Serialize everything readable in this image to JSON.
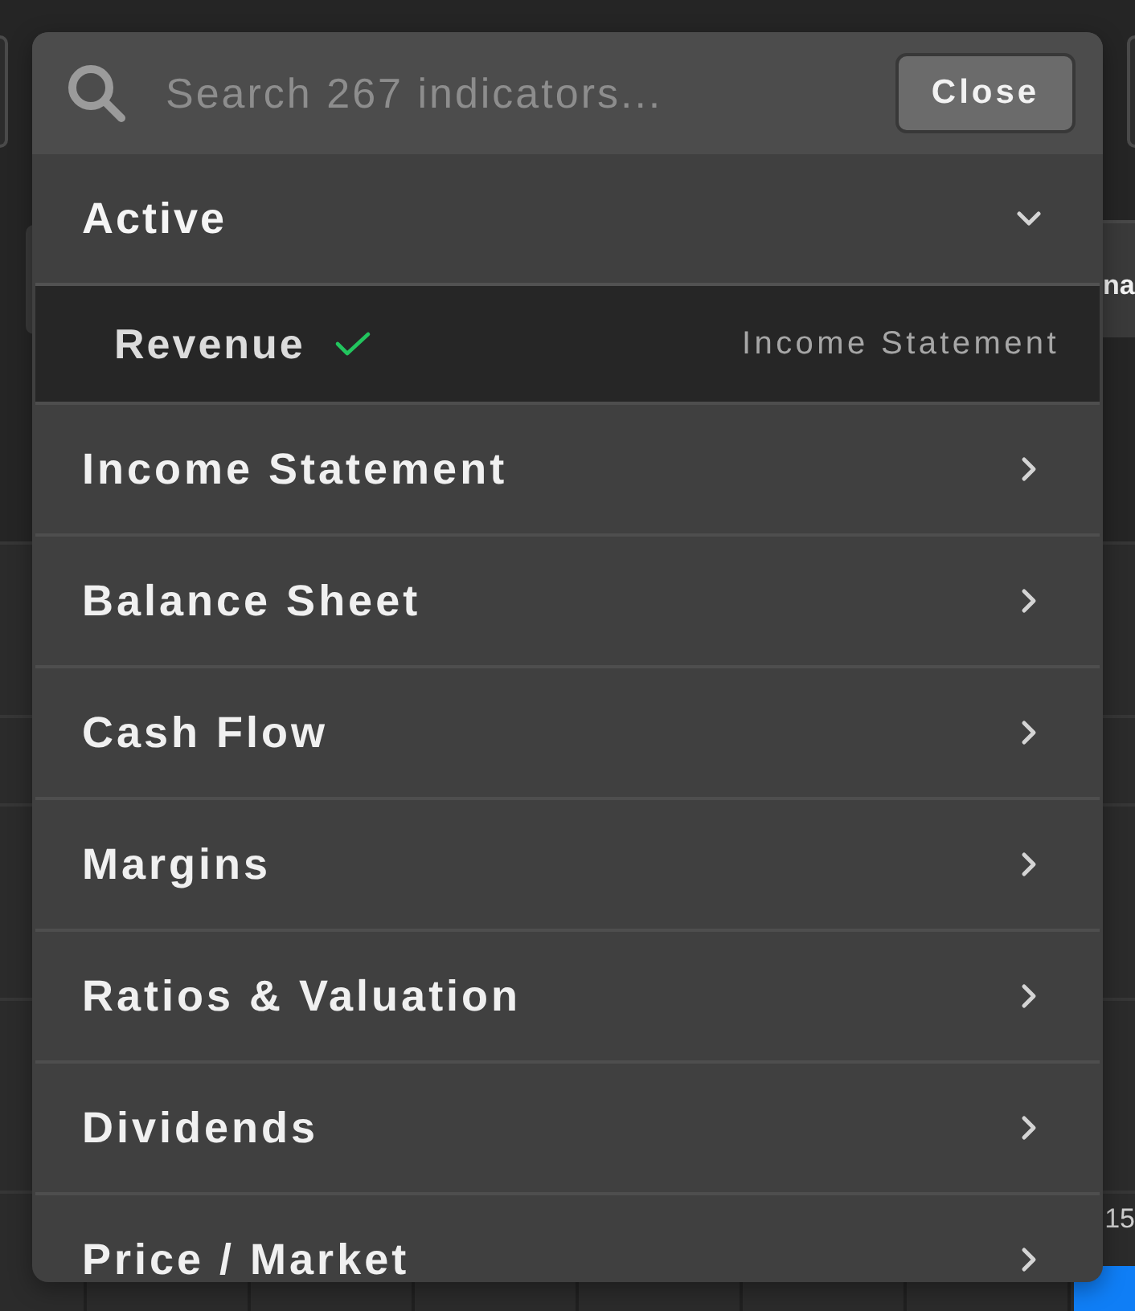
{
  "search": {
    "placeholder": "Search 267 indicators...",
    "close_button": "Close"
  },
  "active_section": {
    "title": "Active",
    "expanded": true,
    "items": [
      {
        "name": "Revenue",
        "checked": true,
        "category": "Income Statement"
      }
    ]
  },
  "categories": [
    {
      "label": "Income Statement",
      "expanded": false
    },
    {
      "label": "Balance Sheet",
      "expanded": false
    },
    {
      "label": "Cash Flow",
      "expanded": false
    },
    {
      "label": "Margins",
      "expanded": false
    },
    {
      "label": "Ratios & Valuation",
      "expanded": false
    },
    {
      "label": "Dividends",
      "expanded": false
    },
    {
      "label": "Price / Market",
      "expanded": false
    }
  ],
  "background": {
    "button_label": "na",
    "axis_label": "15"
  }
}
